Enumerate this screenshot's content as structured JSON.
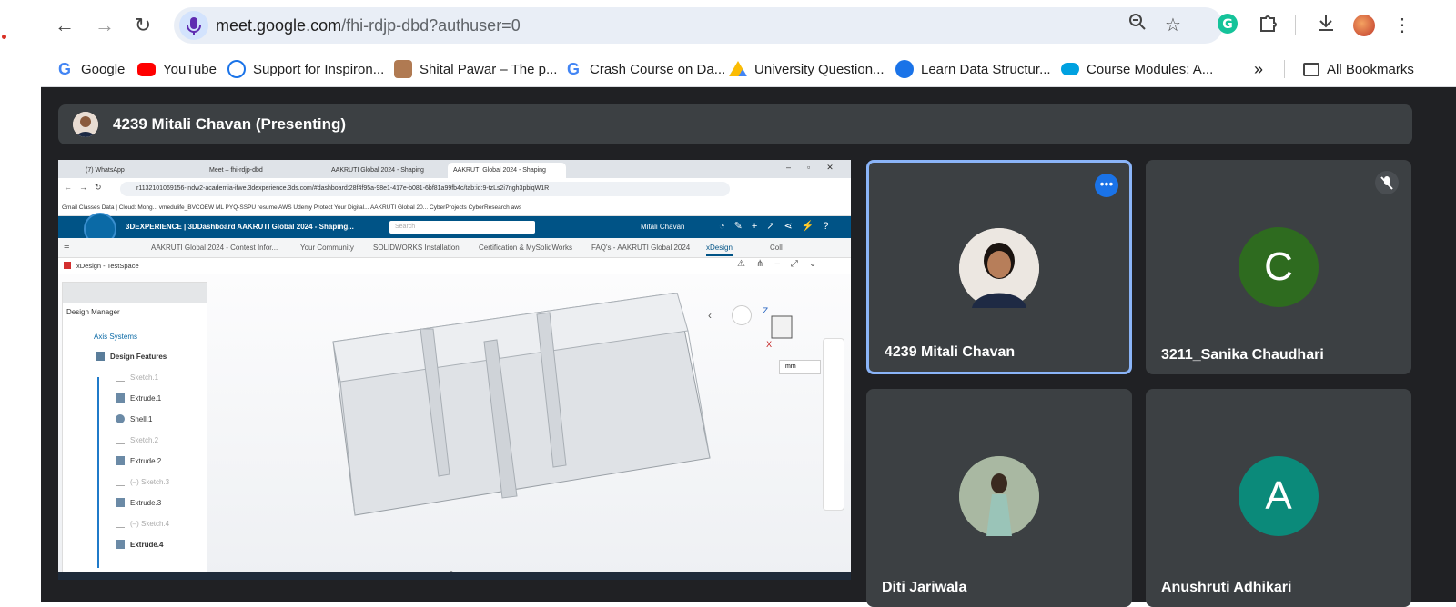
{
  "browser": {
    "url_host": "meet.google.com",
    "url_path": "/fhi-rdjp-dbd?authuser=0",
    "bookmarks": [
      {
        "label": "Google",
        "color": "#4285f4"
      },
      {
        "label": "YouTube",
        "color": "#ff0000"
      },
      {
        "label": "Support for Inspiron...",
        "color": "#1a73e8"
      },
      {
        "label": "Shital Pawar – The p...",
        "color": "#b07a52"
      },
      {
        "label": "Crash Course on Da...",
        "color": "#4285f4"
      },
      {
        "label": "University Question...",
        "color": "#fbbc04"
      },
      {
        "label": "Learn Data Structur...",
        "color": "#1a73e8"
      },
      {
        "label": "Course Modules: A...",
        "color": "#00a1e0"
      }
    ],
    "more_bookmarks": "»",
    "all_bookmarks": "All Bookmarks"
  },
  "meet": {
    "presenter_bar": "4239 Mitali Chavan (Presenting)",
    "tiles": [
      {
        "name": "4239 Mitali Chavan",
        "avatar_type": "photo",
        "active_speaker": true,
        "menu_icon": "more-horiz-icon"
      },
      {
        "name": "3211_Sanika Chaudhari",
        "avatar_letter": "C",
        "avatar_color": "#2e6b1f",
        "muted_icon": "mic-off-icon"
      },
      {
        "name": "Diti Jariwala",
        "avatar_type": "photo"
      },
      {
        "name": "Anushruti Adhikari",
        "avatar_letter": "A",
        "avatar_color": "#0b8a7a"
      }
    ]
  },
  "shared_screen": {
    "tabs": [
      "(7) WhatsApp",
      "Meet – fhi-rdjp-dbd",
      "AAKRUTI Global 2024 - Shaping",
      "AAKRUTI Global 2024 - Shaping"
    ],
    "url": "r1132101069156-indw2-academia-ifwe.3dexperience.3ds.com/#dashboard:28f4f95a-98e1-417e-b081-6bf81a99fb4c/tab:id:9-tzLs2i7ngh3pbiqW1R",
    "bookmarks_line": "Gmail   Classes   Data | Cloud: Mong...   vmedulife_BVCOEW   ML   PYQ-SSPU   resume   AWS   Udemy   Protect Your Digital...   AAKRUTI Global 20...   CyberProjects   CyberResearch   aws",
    "app_title": "3DEXPERIENCE | 3DDashboard AAKRUTI Global 2024 - Shaping...",
    "search_placeholder": "Search",
    "user": "Mitali Chavan",
    "nav_items": [
      "AAKRUTI Global 2024 - Contest Infor...",
      "Your Community",
      "SOLIDWORKS Installation",
      "Certification & MySolidWorks",
      "FAQ's - AAKRUTI Global 2024",
      "xDesign",
      "Coll"
    ],
    "workspace": "xDesign - TestSpace",
    "tree_title": "Design Manager",
    "tree_items": [
      {
        "label": "Axis Systems",
        "state": "link"
      },
      {
        "label": "Design Features",
        "state": "bold"
      },
      {
        "label": "Sketch.1",
        "state": "dim"
      },
      {
        "label": "Extrude.1",
        "state": "normal"
      },
      {
        "label": "Shell.1",
        "state": "normal"
      },
      {
        "label": "Sketch.2",
        "state": "dim"
      },
      {
        "label": "Extrude.2",
        "state": "normal"
      },
      {
        "label": "(–)   Sketch.3",
        "state": "dim"
      },
      {
        "label": "Extrude.3",
        "state": "normal"
      },
      {
        "label": "(–)   Sketch.4",
        "state": "dim"
      },
      {
        "label": "Extrude.4",
        "state": "bold"
      }
    ],
    "units": "mm"
  }
}
